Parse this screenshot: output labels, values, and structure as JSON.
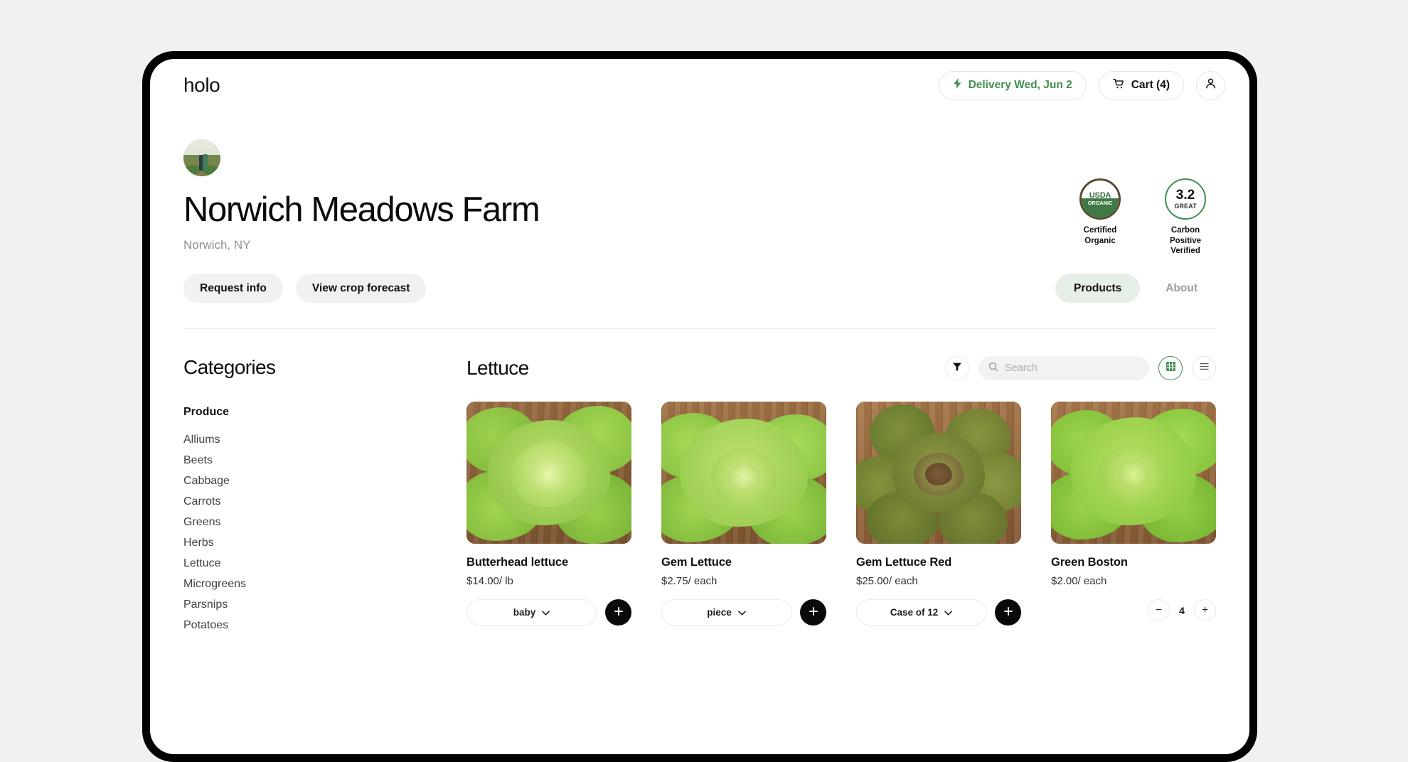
{
  "header": {
    "brand": "holo",
    "delivery_label": "Delivery Wed, Jun 2",
    "cart_label": "Cart (4)",
    "accent_green": "#3f8f4f"
  },
  "farm": {
    "name": "Norwich Meadows Farm",
    "location": "Norwich, NY",
    "buttons": [
      {
        "label": "Request info"
      },
      {
        "label": "View crop forecast"
      }
    ],
    "tabs": [
      {
        "label": "Products",
        "active": true
      },
      {
        "label": "About",
        "active": false
      }
    ],
    "badges": [
      {
        "seal_top": "USDA",
        "seal_bottom": "ORGANIC",
        "caption_line1": "Certified",
        "caption_line2": "Organic"
      },
      {
        "score": "3.2",
        "score_label": "GREAT",
        "caption_line1": "Carbon Positive",
        "caption_line2": "Verified"
      }
    ]
  },
  "sidebar": {
    "title": "Categories",
    "group_title": "Produce",
    "items": [
      {
        "label": "Alliums"
      },
      {
        "label": "Beets"
      },
      {
        "label": "Cabbage"
      },
      {
        "label": "Carrots"
      },
      {
        "label": "Greens"
      },
      {
        "label": "Herbs"
      },
      {
        "label": "Lettuce"
      },
      {
        "label": "Microgreens"
      },
      {
        "label": "Parsnips"
      },
      {
        "label": "Potatoes"
      }
    ]
  },
  "main": {
    "title": "Lettuce",
    "search_placeholder": "Search",
    "search_value": "",
    "view_mode": "grid",
    "products": [
      {
        "name": "Butterhead lettuce",
        "price": "$14.00/ lb",
        "variant": "baby",
        "control": "add"
      },
      {
        "name": "Gem Lettuce",
        "price": "$2.75/ each",
        "variant": "piece",
        "control": "add"
      },
      {
        "name": "Gem Lettuce Red",
        "price": "$25.00/ each",
        "variant": "Case of 12",
        "control": "add"
      },
      {
        "name": "Green Boston",
        "price": "$2.00/ each",
        "control": "stepper",
        "quantity": "4",
        "decrement": "−",
        "increment": "+"
      }
    ]
  }
}
